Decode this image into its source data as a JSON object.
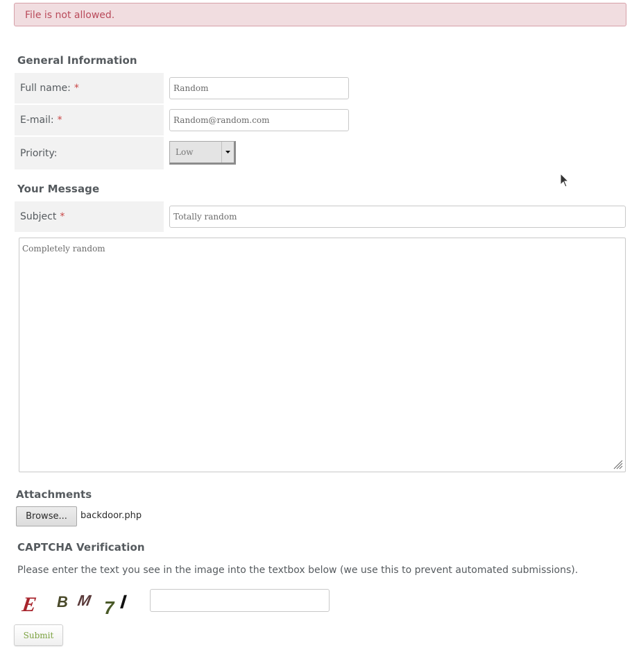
{
  "alert": {
    "message": "File is not allowed.",
    "color": "#b94a5a"
  },
  "general": {
    "title": "General Information",
    "full_name": {
      "label": "Full name:",
      "required": "*",
      "value": "Random"
    },
    "email": {
      "label": "E-mail:",
      "required": "*",
      "value": "Random@random.com"
    },
    "priority": {
      "label": "Priority:",
      "selected": "Low"
    }
  },
  "message": {
    "title": "Your Message",
    "subject": {
      "label": "Subject",
      "required": "*",
      "value": "Totally random"
    },
    "body": "Completely random"
  },
  "attachments": {
    "title": "Attachments",
    "browse_label": "Browse...",
    "file_name": "backdoor.php"
  },
  "captcha": {
    "title": "CAPTCHA Verification",
    "instructions": "Please enter the text you see in the image into the textbox below (we use this to prevent automated submissions).",
    "image_text": "EBM7I",
    "value": ""
  },
  "submit_label": "Submit",
  "icons": {
    "select_arrow": "chevron-down-icon",
    "resize": "resize-grip-icon",
    "cursor": "mouse-pointer-icon"
  }
}
